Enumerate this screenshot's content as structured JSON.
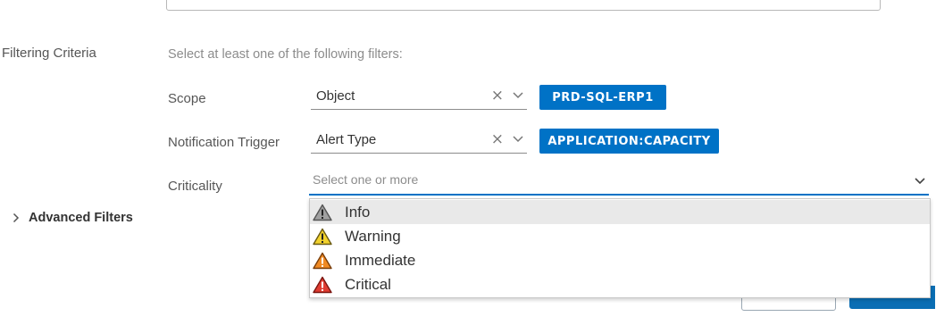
{
  "form": {
    "section_label": "Filtering Criteria",
    "hint": "Select at least one of the following filters:",
    "scope": {
      "label": "Scope",
      "value": "Object",
      "chip": "PRD-SQL-ERP1"
    },
    "trigger": {
      "label": "Notification Trigger",
      "value": "Alert Type",
      "chip": "APPLICATION:CAPACITY"
    },
    "criticality": {
      "label": "Criticality",
      "placeholder": "Select one or more"
    },
    "advanced_label": "Advanced Filters"
  },
  "dropdown": {
    "options": [
      {
        "label": "Info",
        "icon": "warning-gray-icon",
        "color": "#9e9e9e"
      },
      {
        "label": "Warning",
        "icon": "warning-yellow-icon",
        "color": "#f2d22e"
      },
      {
        "label": "Immediate",
        "icon": "warning-orange-icon",
        "color": "#f08a24"
      },
      {
        "label": "Critical",
        "icon": "warning-red-icon",
        "color": "#e03c31"
      }
    ]
  },
  "colors": {
    "accent": "#0072c6"
  }
}
